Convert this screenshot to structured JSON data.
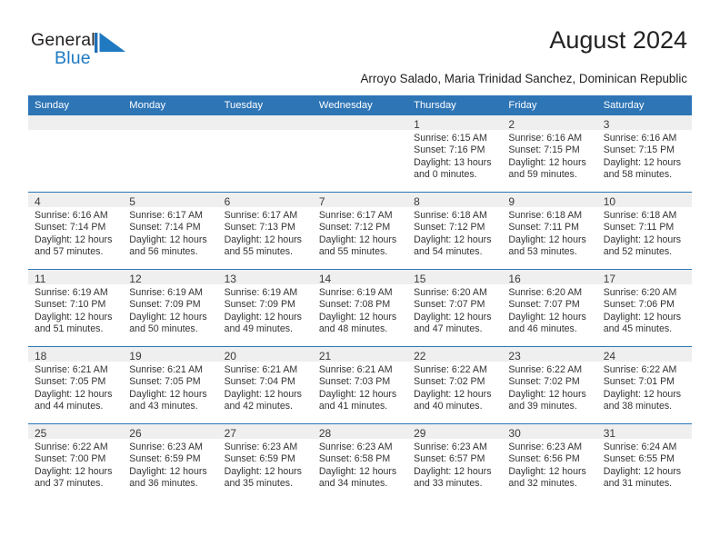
{
  "brand": {
    "name_part1": "General",
    "name_part2": "Blue",
    "accent_color": "#1f7ac2",
    "flag_icon": "flag-triangle-icon"
  },
  "header": {
    "title": "August 2024",
    "location": "Arroyo Salado, Maria Trinidad Sanchez, Dominican Republic"
  },
  "theme": {
    "header_blue": "#2e75b6",
    "daynum_gray": "#efefef"
  },
  "weekday_headers": [
    "Sunday",
    "Monday",
    "Tuesday",
    "Wednesday",
    "Thursday",
    "Friday",
    "Saturday"
  ],
  "weeks": [
    [
      {
        "day": "",
        "sunrise": "",
        "sunset": "",
        "daylight_line1": "",
        "daylight_line2": ""
      },
      {
        "day": "",
        "sunrise": "",
        "sunset": "",
        "daylight_line1": "",
        "daylight_line2": ""
      },
      {
        "day": "",
        "sunrise": "",
        "sunset": "",
        "daylight_line1": "",
        "daylight_line2": ""
      },
      {
        "day": "",
        "sunrise": "",
        "sunset": "",
        "daylight_line1": "",
        "daylight_line2": ""
      },
      {
        "day": "1",
        "sunrise": "Sunrise: 6:15 AM",
        "sunset": "Sunset: 7:16 PM",
        "daylight_line1": "Daylight: 13 hours",
        "daylight_line2": "and 0 minutes."
      },
      {
        "day": "2",
        "sunrise": "Sunrise: 6:16 AM",
        "sunset": "Sunset: 7:15 PM",
        "daylight_line1": "Daylight: 12 hours",
        "daylight_line2": "and 59 minutes."
      },
      {
        "day": "3",
        "sunrise": "Sunrise: 6:16 AM",
        "sunset": "Sunset: 7:15 PM",
        "daylight_line1": "Daylight: 12 hours",
        "daylight_line2": "and 58 minutes."
      }
    ],
    [
      {
        "day": "4",
        "sunrise": "Sunrise: 6:16 AM",
        "sunset": "Sunset: 7:14 PM",
        "daylight_line1": "Daylight: 12 hours",
        "daylight_line2": "and 57 minutes."
      },
      {
        "day": "5",
        "sunrise": "Sunrise: 6:17 AM",
        "sunset": "Sunset: 7:14 PM",
        "daylight_line1": "Daylight: 12 hours",
        "daylight_line2": "and 56 minutes."
      },
      {
        "day": "6",
        "sunrise": "Sunrise: 6:17 AM",
        "sunset": "Sunset: 7:13 PM",
        "daylight_line1": "Daylight: 12 hours",
        "daylight_line2": "and 55 minutes."
      },
      {
        "day": "7",
        "sunrise": "Sunrise: 6:17 AM",
        "sunset": "Sunset: 7:12 PM",
        "daylight_line1": "Daylight: 12 hours",
        "daylight_line2": "and 55 minutes."
      },
      {
        "day": "8",
        "sunrise": "Sunrise: 6:18 AM",
        "sunset": "Sunset: 7:12 PM",
        "daylight_line1": "Daylight: 12 hours",
        "daylight_line2": "and 54 minutes."
      },
      {
        "day": "9",
        "sunrise": "Sunrise: 6:18 AM",
        "sunset": "Sunset: 7:11 PM",
        "daylight_line1": "Daylight: 12 hours",
        "daylight_line2": "and 53 minutes."
      },
      {
        "day": "10",
        "sunrise": "Sunrise: 6:18 AM",
        "sunset": "Sunset: 7:11 PM",
        "daylight_line1": "Daylight: 12 hours",
        "daylight_line2": "and 52 minutes."
      }
    ],
    [
      {
        "day": "11",
        "sunrise": "Sunrise: 6:19 AM",
        "sunset": "Sunset: 7:10 PM",
        "daylight_line1": "Daylight: 12 hours",
        "daylight_line2": "and 51 minutes."
      },
      {
        "day": "12",
        "sunrise": "Sunrise: 6:19 AM",
        "sunset": "Sunset: 7:09 PM",
        "daylight_line1": "Daylight: 12 hours",
        "daylight_line2": "and 50 minutes."
      },
      {
        "day": "13",
        "sunrise": "Sunrise: 6:19 AM",
        "sunset": "Sunset: 7:09 PM",
        "daylight_line1": "Daylight: 12 hours",
        "daylight_line2": "and 49 minutes."
      },
      {
        "day": "14",
        "sunrise": "Sunrise: 6:19 AM",
        "sunset": "Sunset: 7:08 PM",
        "daylight_line1": "Daylight: 12 hours",
        "daylight_line2": "and 48 minutes."
      },
      {
        "day": "15",
        "sunrise": "Sunrise: 6:20 AM",
        "sunset": "Sunset: 7:07 PM",
        "daylight_line1": "Daylight: 12 hours",
        "daylight_line2": "and 47 minutes."
      },
      {
        "day": "16",
        "sunrise": "Sunrise: 6:20 AM",
        "sunset": "Sunset: 7:07 PM",
        "daylight_line1": "Daylight: 12 hours",
        "daylight_line2": "and 46 minutes."
      },
      {
        "day": "17",
        "sunrise": "Sunrise: 6:20 AM",
        "sunset": "Sunset: 7:06 PM",
        "daylight_line1": "Daylight: 12 hours",
        "daylight_line2": "and 45 minutes."
      }
    ],
    [
      {
        "day": "18",
        "sunrise": "Sunrise: 6:21 AM",
        "sunset": "Sunset: 7:05 PM",
        "daylight_line1": "Daylight: 12 hours",
        "daylight_line2": "and 44 minutes."
      },
      {
        "day": "19",
        "sunrise": "Sunrise: 6:21 AM",
        "sunset": "Sunset: 7:05 PM",
        "daylight_line1": "Daylight: 12 hours",
        "daylight_line2": "and 43 minutes."
      },
      {
        "day": "20",
        "sunrise": "Sunrise: 6:21 AM",
        "sunset": "Sunset: 7:04 PM",
        "daylight_line1": "Daylight: 12 hours",
        "daylight_line2": "and 42 minutes."
      },
      {
        "day": "21",
        "sunrise": "Sunrise: 6:21 AM",
        "sunset": "Sunset: 7:03 PM",
        "daylight_line1": "Daylight: 12 hours",
        "daylight_line2": "and 41 minutes."
      },
      {
        "day": "22",
        "sunrise": "Sunrise: 6:22 AM",
        "sunset": "Sunset: 7:02 PM",
        "daylight_line1": "Daylight: 12 hours",
        "daylight_line2": "and 40 minutes."
      },
      {
        "day": "23",
        "sunrise": "Sunrise: 6:22 AM",
        "sunset": "Sunset: 7:02 PM",
        "daylight_line1": "Daylight: 12 hours",
        "daylight_line2": "and 39 minutes."
      },
      {
        "day": "24",
        "sunrise": "Sunrise: 6:22 AM",
        "sunset": "Sunset: 7:01 PM",
        "daylight_line1": "Daylight: 12 hours",
        "daylight_line2": "and 38 minutes."
      }
    ],
    [
      {
        "day": "25",
        "sunrise": "Sunrise: 6:22 AM",
        "sunset": "Sunset: 7:00 PM",
        "daylight_line1": "Daylight: 12 hours",
        "daylight_line2": "and 37 minutes."
      },
      {
        "day": "26",
        "sunrise": "Sunrise: 6:23 AM",
        "sunset": "Sunset: 6:59 PM",
        "daylight_line1": "Daylight: 12 hours",
        "daylight_line2": "and 36 minutes."
      },
      {
        "day": "27",
        "sunrise": "Sunrise: 6:23 AM",
        "sunset": "Sunset: 6:59 PM",
        "daylight_line1": "Daylight: 12 hours",
        "daylight_line2": "and 35 minutes."
      },
      {
        "day": "28",
        "sunrise": "Sunrise: 6:23 AM",
        "sunset": "Sunset: 6:58 PM",
        "daylight_line1": "Daylight: 12 hours",
        "daylight_line2": "and 34 minutes."
      },
      {
        "day": "29",
        "sunrise": "Sunrise: 6:23 AM",
        "sunset": "Sunset: 6:57 PM",
        "daylight_line1": "Daylight: 12 hours",
        "daylight_line2": "and 33 minutes."
      },
      {
        "day": "30",
        "sunrise": "Sunrise: 6:23 AM",
        "sunset": "Sunset: 6:56 PM",
        "daylight_line1": "Daylight: 12 hours",
        "daylight_line2": "and 32 minutes."
      },
      {
        "day": "31",
        "sunrise": "Sunrise: 6:24 AM",
        "sunset": "Sunset: 6:55 PM",
        "daylight_line1": "Daylight: 12 hours",
        "daylight_line2": "and 31 minutes."
      }
    ]
  ]
}
